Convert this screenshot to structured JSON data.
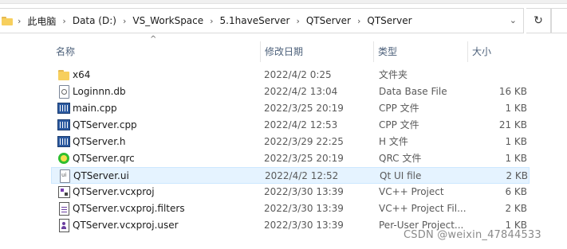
{
  "address_bar": {
    "crumbs": [
      "此电脑",
      "Data (D:)",
      "VS_WorkSpace",
      "5.1haveServer",
      "QTServer",
      "QTServer"
    ]
  },
  "columns": {
    "name": "名称",
    "date": "修改日期",
    "type": "类型",
    "size": "大小"
  },
  "files": [
    {
      "icon": "folder-icon",
      "name": "x64",
      "date": "2022/4/2 0:25",
      "type": "文件夹",
      "size": ""
    },
    {
      "icon": "database-file-icon",
      "name": "Loginnn.db",
      "date": "2022/4/2 13:04",
      "type": "Data Base File",
      "size": "16 KB"
    },
    {
      "icon": "cpp-file-icon",
      "name": "main.cpp",
      "date": "2022/3/25 20:19",
      "type": "CPP 文件",
      "size": "1 KB"
    },
    {
      "icon": "cpp-file-icon",
      "name": "QTServer.cpp",
      "date": "2022/4/2 12:53",
      "type": "CPP 文件",
      "size": "21 KB"
    },
    {
      "icon": "header-file-icon",
      "name": "QTServer.h",
      "date": "2022/3/29 22:25",
      "type": "H 文件",
      "size": "1 KB"
    },
    {
      "icon": "qrc-file-icon",
      "name": "QTServer.qrc",
      "date": "2022/3/25 20:19",
      "type": "QRC 文件",
      "size": "1 KB"
    },
    {
      "icon": "ui-file-icon",
      "name": "QTServer.ui",
      "date": "2022/4/2 12:52",
      "type": "Qt UI file",
      "size": "2 KB",
      "selected": true
    },
    {
      "icon": "vcxproj-file-icon",
      "name": "QTServer.vcxproj",
      "date": "2022/3/30 13:39",
      "type": "VC++ Project",
      "size": "6 KB"
    },
    {
      "icon": "filters-file-icon",
      "name": "QTServer.vcxproj.filters",
      "date": "2022/3/30 13:39",
      "type": "VC++ Project Fil...",
      "size": "2 KB"
    },
    {
      "icon": "user-file-icon",
      "name": "QTServer.vcxproj.user",
      "date": "2022/3/30 13:39",
      "type": "Per-User Project...",
      "size": "1 KB"
    }
  ],
  "watermark": "CSDN @weixin_47844533"
}
